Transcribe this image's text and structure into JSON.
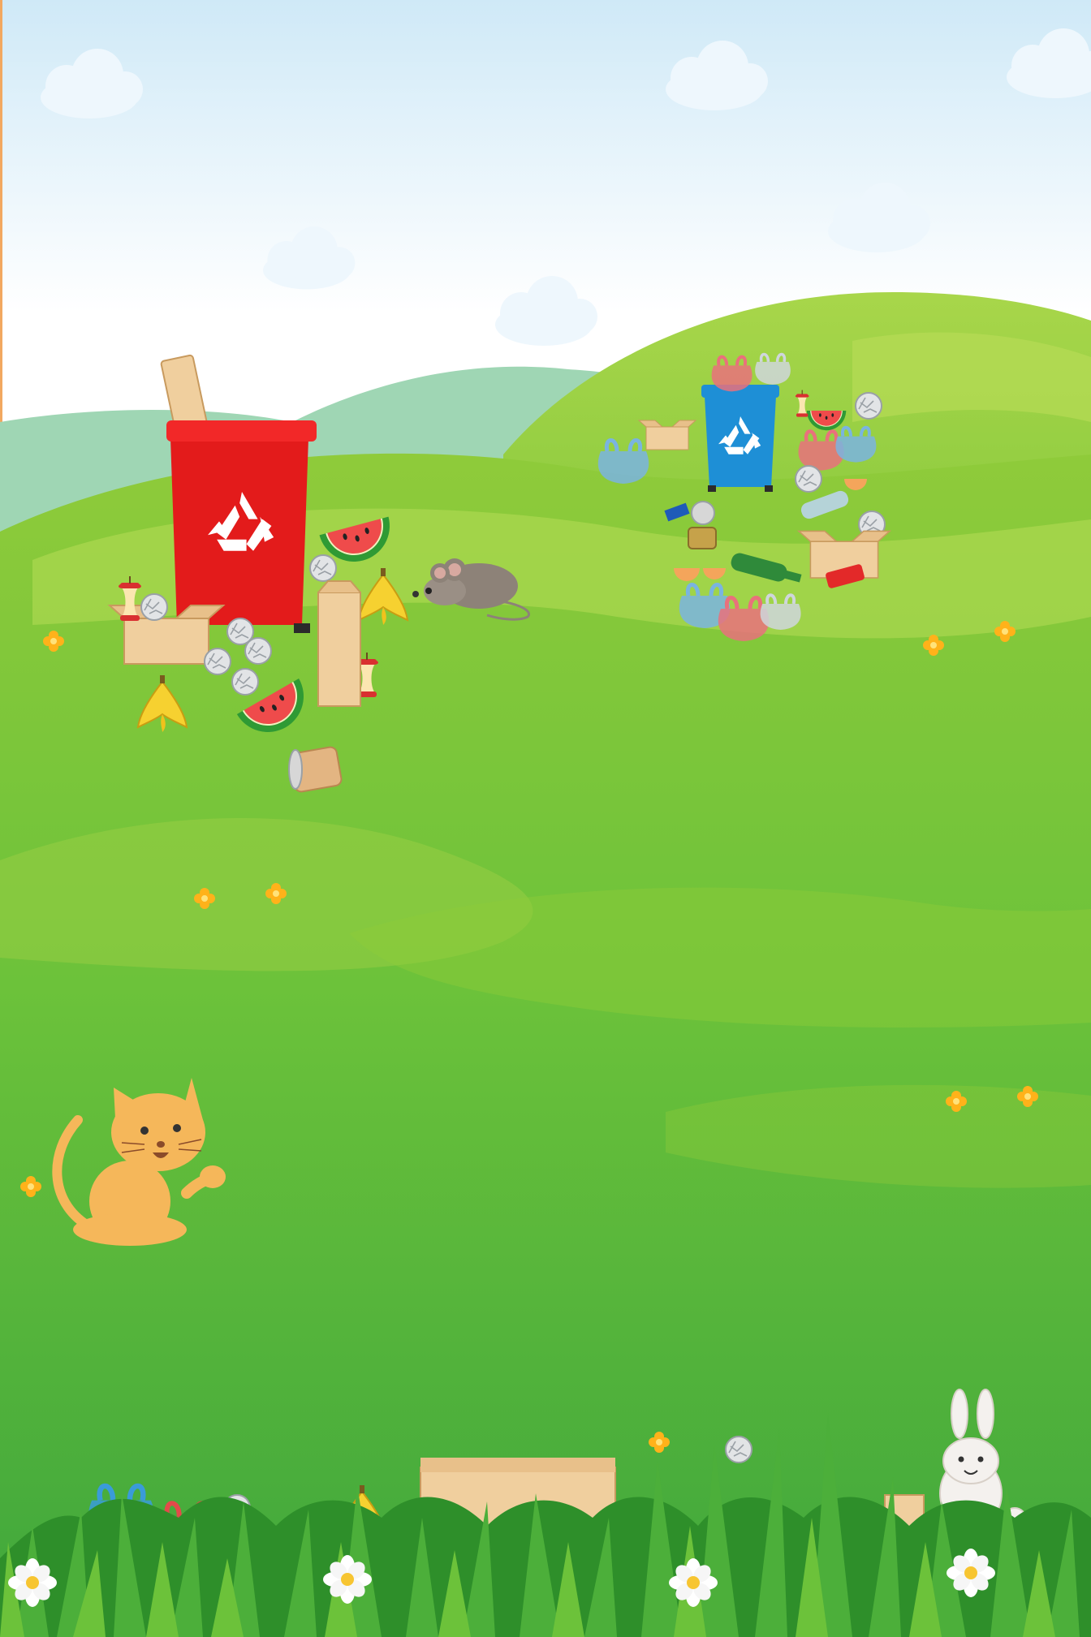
{
  "scene": {
    "colors": {
      "sky_top": "#cfe9f7",
      "sky_bottom": "#ffffff",
      "far_hill": "#9fd6b4",
      "hill_light": "#b6dc55",
      "hill_mid": "#8fcb3a",
      "meadow": "#6cc23a",
      "meadow_dark": "#3fa73c",
      "red_bin": "#e31b1b",
      "blue_bin": "#1e8fd6",
      "cat": "#f5b75a",
      "mouse": "#8d8278",
      "rabbit": "#f4f1ee",
      "flower": "#ffb21a",
      "daisy": "#ffffff"
    },
    "icons": [
      "cloud-icon",
      "recycle-icon",
      "red-recycling-bin",
      "blue-recycling-bin",
      "cat-icon",
      "mouse-icon",
      "rabbit-icon",
      "banana-peel-icon",
      "watermelon-rind-icon",
      "apple-core-icon",
      "crumpled-paper-icon",
      "cardboard-box-icon",
      "paper-bag-icon",
      "plastic-bag-icon",
      "bottle-icon",
      "can-icon",
      "eggshell-icon",
      "flower-icon",
      "daisy-icon",
      "grass-icon"
    ]
  }
}
